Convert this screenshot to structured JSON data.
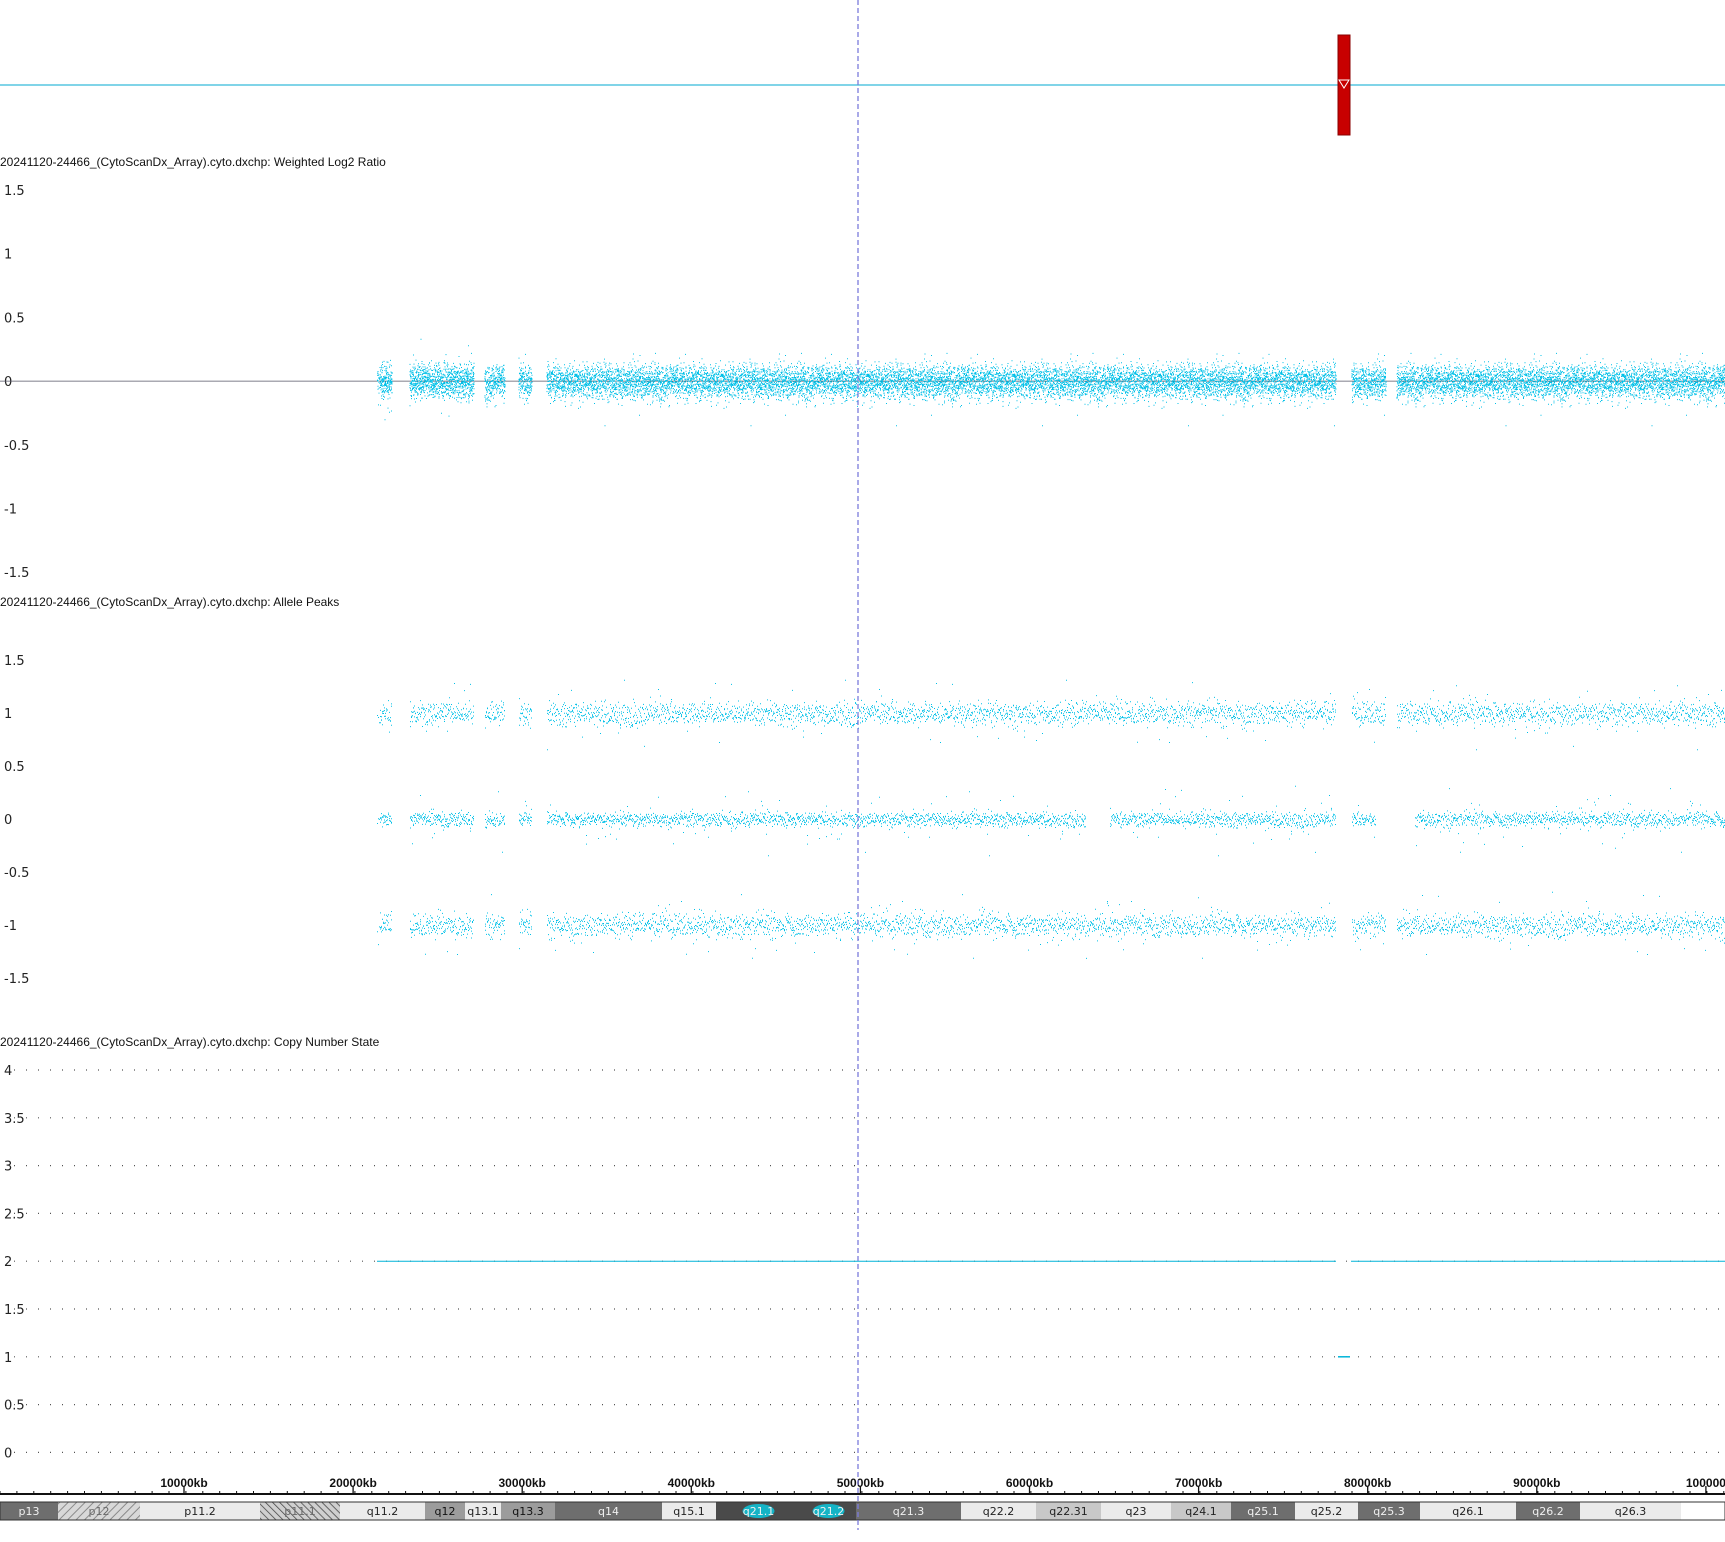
{
  "colors": {
    "data": "#00c0e8",
    "cursor": "#7b7bdc",
    "marker": "#c80000",
    "cn_line": "#00b4d8",
    "dotted_grid": "#555555"
  },
  "tracks": {
    "log2": {
      "title": "20241120-24466_(CytoScanDx_Array).cyto.dxchp: Weighted Log2 Ratio",
      "ticks": [
        "1.5",
        "1",
        "0.5",
        "0",
        "-0.5",
        "-1",
        "-1.5"
      ]
    },
    "allele": {
      "title": "20241120-24466_(CytoScanDx_Array).cyto.dxchp: Allele Peaks",
      "ticks": [
        "1.5",
        "1",
        "0.5",
        "0",
        "-0.5",
        "-1",
        "-1.5"
      ]
    },
    "cn": {
      "title": "20241120-24466_(CytoScanDx_Array).cyto.dxchp: Copy Number State",
      "ticks": [
        "4",
        "3.5",
        "3",
        "2.5",
        "2",
        "1.5",
        "1",
        "0.5",
        "0"
      ]
    }
  },
  "ruler": {
    "labels": [
      "10000kb",
      "20000kb",
      "30000kb",
      "40000kb",
      "50000kb",
      "60000kb",
      "70000kb",
      "80000kb",
      "90000kb",
      "100000"
    ]
  },
  "ideogram": {
    "bands": [
      {
        "name": "p13",
        "stain": "gpos75"
      },
      {
        "name": "p12",
        "stain": "stalk"
      },
      {
        "name": "p11.2",
        "stain": "gneg"
      },
      {
        "name": "p11.1",
        "stain": "acen"
      },
      {
        "name": "q11.2",
        "stain": "gneg"
      },
      {
        "name": "q12",
        "stain": "gpos50"
      },
      {
        "name": "q13.1",
        "stain": "gneg"
      },
      {
        "name": "q13.3",
        "stain": "gpos50"
      },
      {
        "name": "q14",
        "stain": "gpos75"
      },
      {
        "name": "q15.1",
        "stain": "gneg"
      },
      {
        "name": "q21.1",
        "stain": "gpos100"
      },
      {
        "name": "q21.2",
        "stain": "gpos100"
      },
      {
        "name": "q21.3",
        "stain": "gpos75"
      },
      {
        "name": "q22.2",
        "stain": "gneg"
      },
      {
        "name": "q22.31",
        "stain": "gpos25"
      },
      {
        "name": "q23",
        "stain": "gneg"
      },
      {
        "name": "q24.1",
        "stain": "gpos25"
      },
      {
        "name": "q25.1",
        "stain": "gpos75"
      },
      {
        "name": "q25.2",
        "stain": "gneg"
      },
      {
        "name": "q25.3",
        "stain": "gpos75"
      },
      {
        "name": "q26.1",
        "stain": "gneg"
      },
      {
        "name": "q26.2",
        "stain": "gpos75"
      },
      {
        "name": "q26.3",
        "stain": "gneg"
      }
    ]
  }
}
